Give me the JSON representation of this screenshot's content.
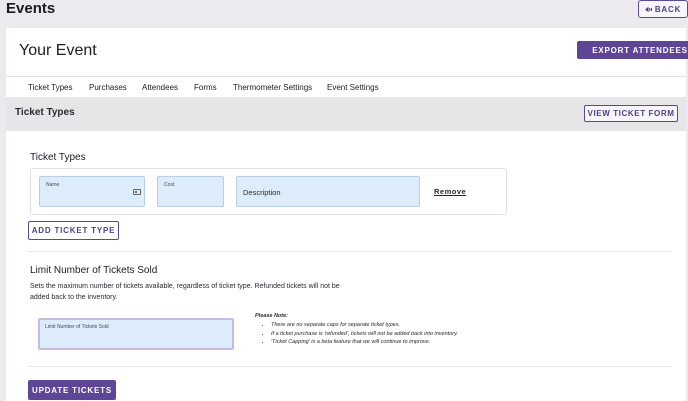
{
  "page": {
    "title": "Events",
    "back_label": "BACK"
  },
  "event": {
    "title": "Your Event",
    "export_label": "EXPORT ATTENDEES"
  },
  "tabs": [
    {
      "label": "Ticket Types"
    },
    {
      "label": "Purchases"
    },
    {
      "label": "Attendees"
    },
    {
      "label": "Forms"
    },
    {
      "label": "Thermometer Settings"
    },
    {
      "label": "Event Settings"
    }
  ],
  "section": {
    "title": "Ticket Types",
    "view_form_label": "VIEW TICKET FORM"
  },
  "ticket_types": {
    "heading": "Ticket Types",
    "name_label": "Name",
    "name_value": "",
    "cost_label": "Cost",
    "cost_value": "",
    "description_placeholder": "Description",
    "remove_label": "Remove",
    "add_label": "ADD TICKET TYPE"
  },
  "limit": {
    "heading": "Limit Number of Tickets Sold",
    "description": "Sets the maximum number of tickets available, regardless of ticket type. Refunded tickets will not be added back to the inventory.",
    "field_label": "Limit Number of Tickets Sold",
    "field_value": "",
    "note_title": "Please Note:",
    "notes": [
      "There are no separate caps for separate ticket types.",
      "If a ticket purchase is 'refunded', tickets will not be added back into inventory.",
      "'Ticket Capping' is a beta feature that we will continue to improve."
    ]
  },
  "footer": {
    "update_label": "UPDATE TICKETS"
  },
  "colors": {
    "accent": "#5e4596",
    "field_bg": "#dcecfa",
    "page_bg": "#eceaef"
  }
}
